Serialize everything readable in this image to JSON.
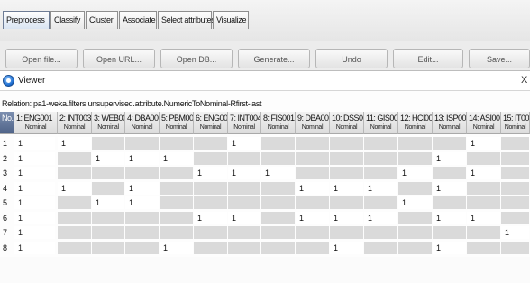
{
  "tabs": [
    {
      "label": "Preprocess",
      "active": true
    },
    {
      "label": "Classify",
      "active": false
    },
    {
      "label": "Cluster",
      "active": false
    },
    {
      "label": "Associate",
      "active": false
    },
    {
      "label": "Select attributes",
      "active": false
    },
    {
      "label": "Visualize",
      "active": false
    }
  ],
  "background_buttons": [
    "Open file...",
    "Open URL...",
    "Open DB...",
    "Generate...",
    "Undo",
    "Edit...",
    "Save..."
  ],
  "viewer": {
    "title": "Viewer",
    "close_label": "X",
    "relation": "Relation: pa1-weka.filters.unsupervised.attribute.NumericToNominal-Rfirst-last"
  },
  "columns": [
    {
      "name": "No.",
      "type": ""
    },
    {
      "name": "1: ENG001",
      "type": "Nominal"
    },
    {
      "name": "2: INT003",
      "type": "Nominal"
    },
    {
      "name": "3: WEB001",
      "type": "Nominal"
    },
    {
      "name": "4: DBA001",
      "type": "Nominal"
    },
    {
      "name": "5: PBM002",
      "type": "Nominal"
    },
    {
      "name": "6: ENG002",
      "type": "Nominal"
    },
    {
      "name": "7: INT004",
      "type": "Nominal"
    },
    {
      "name": "8: FIS001",
      "type": "Nominal"
    },
    {
      "name": "9: DBA002",
      "type": "Nominal"
    },
    {
      "name": "10: DSS001",
      "type": "Nominal"
    },
    {
      "name": "11: GIS001",
      "type": "Nominal"
    },
    {
      "name": "12: HCI001",
      "type": "Nominal"
    },
    {
      "name": "13: ISP001",
      "type": "Nominal"
    },
    {
      "name": "14: ASI001",
      "type": "Nominal"
    },
    {
      "name": "15: IT00",
      "type": "Nominal"
    }
  ],
  "rows": [
    {
      "no": "1",
      "c1": "1",
      "cells": [
        "1",
        "",
        "",
        "",
        "",
        "1",
        "",
        "",
        "",
        "",
        "",
        "",
        "1",
        ""
      ]
    },
    {
      "no": "2",
      "c1": "1",
      "cells": [
        "",
        "1",
        "1",
        "1",
        "",
        "",
        "",
        "",
        "",
        "",
        "",
        "1",
        "",
        ""
      ]
    },
    {
      "no": "3",
      "c1": "1",
      "cells": [
        "",
        "",
        "",
        "",
        "1",
        "1",
        "1",
        "",
        "",
        "",
        "1",
        "",
        "1",
        ""
      ]
    },
    {
      "no": "4",
      "c1": "1",
      "cells": [
        "1",
        "",
        "1",
        "",
        "",
        "",
        "",
        "1",
        "1",
        "1",
        "",
        "1",
        "",
        ""
      ]
    },
    {
      "no": "5",
      "c1": "1",
      "cells": [
        "",
        "1",
        "1",
        "",
        "",
        "",
        "",
        "",
        "",
        "",
        "1",
        "",
        "",
        ""
      ]
    },
    {
      "no": "6",
      "c1": "1",
      "cells": [
        "",
        "",
        "",
        "",
        "1",
        "1",
        "",
        "1",
        "1",
        "1",
        "",
        "1",
        "1",
        ""
      ]
    },
    {
      "no": "7",
      "c1": "1",
      "cells": [
        "",
        "",
        "",
        "",
        "",
        "",
        "",
        "",
        "",
        "",
        "",
        "",
        "",
        "1"
      ]
    },
    {
      "no": "8",
      "c1": "1",
      "cells": [
        "",
        "",
        "",
        "1",
        "",
        "",
        "",
        "",
        "1",
        "",
        "",
        "1",
        "",
        ""
      ]
    }
  ]
}
